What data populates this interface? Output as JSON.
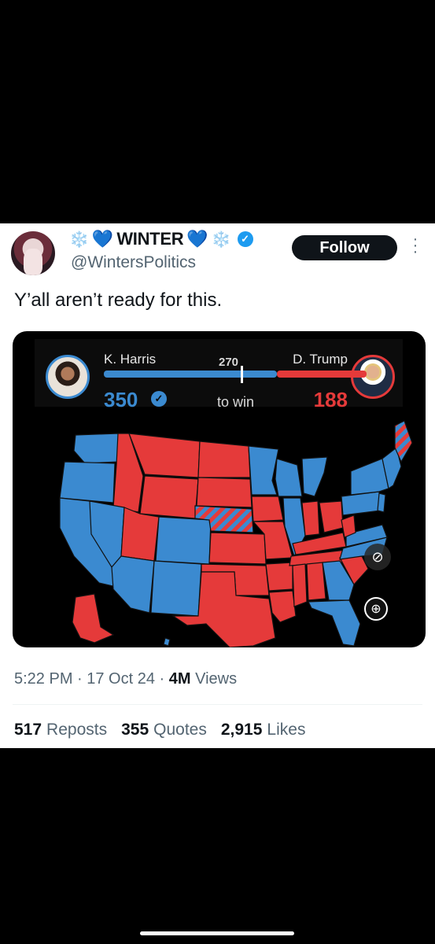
{
  "tweet": {
    "author_decoration_left": "❄️",
    "author_heart_left": "💙",
    "author_name": "WINTER",
    "author_heart_right": "💙",
    "author_decoration_right": "❄️",
    "verified_icon": "verified-badge-icon",
    "handle": "@WintersPolitics",
    "follow_label": "Follow",
    "text": "Y’all aren’t ready for this.",
    "timestamp": "5:22 PM · 17 Oct 24 · ",
    "views_count": "4M",
    "views_label": "Views",
    "stats": {
      "reposts_count": "517",
      "reposts_label": "Reposts",
      "quotes_count": "355",
      "quotes_label": "Quotes",
      "likes_count": "2,915",
      "likes_label": "Likes"
    }
  },
  "media": {
    "left_candidate": "K. Harris",
    "right_candidate": "D. Trump",
    "threshold": "270",
    "left_votes": "350",
    "right_votes": "188",
    "to_win": "to win",
    "colors": {
      "democrat": "#3b8ad0",
      "republican": "#e53a3a"
    },
    "icons": {
      "hide": "eye-off-icon",
      "zoom": "zoom-in-icon"
    }
  }
}
